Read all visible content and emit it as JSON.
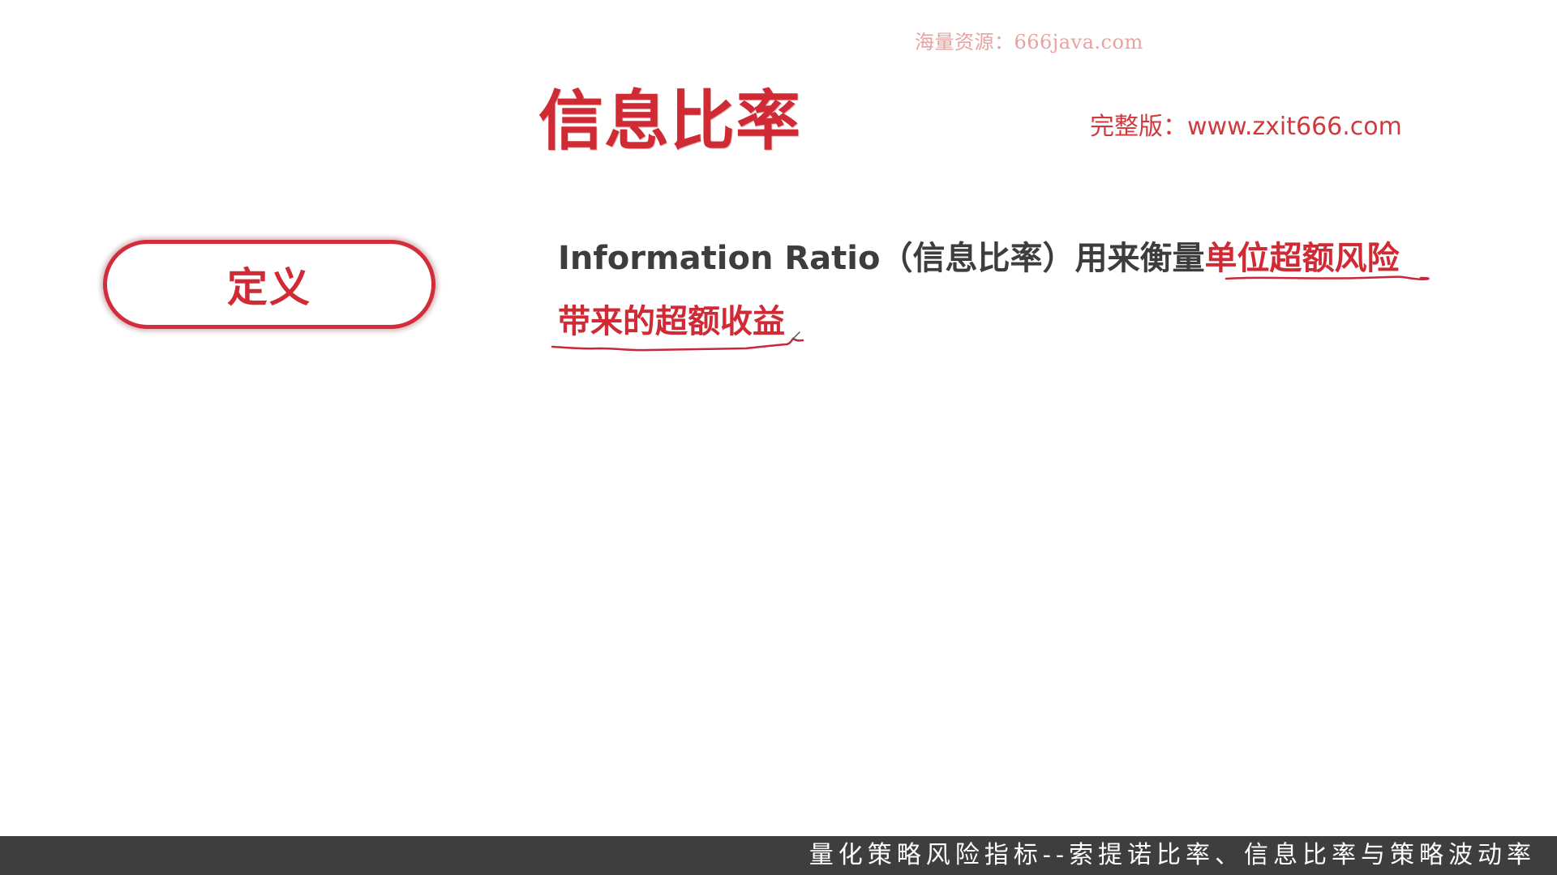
{
  "watermark_top": "海量资源：666java.com",
  "title": "信息比率",
  "watermark_full": "完整版：www.zxit666.com",
  "term_label": "定义",
  "definition": {
    "line1_plain": "Information Ratio（信息比率）用来衡量",
    "line1_highlight": "单位超额风险",
    "line2_highlight": "带来的超额收益"
  },
  "bottom_caption": "量化策略风险指标--索提诺比率、信息比率与策略波动率",
  "colors": {
    "accent_red": "#d02a35",
    "body_text": "#3d3d3d",
    "bar_background": "#3e3e3e"
  }
}
